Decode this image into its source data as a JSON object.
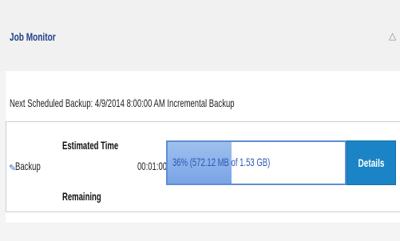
{
  "header": {
    "title": "Job Monitor",
    "collapse_icon": "collapse-up-icon"
  },
  "schedule": {
    "next_backup": "Next Scheduled Backup: 4/9/2014 8:00:00 AM Incremental Backup"
  },
  "job": {
    "type_icon": "backup-icon",
    "type_label": "Backup",
    "estimate_label_line1": "Estimated Time",
    "estimate_label_line2": "Remaining",
    "time_remaining": "00:01:00",
    "progress_fraction": 0.36,
    "progress_text": "36% (572.12 MB of 1.53 GB)",
    "details_label": "Details"
  },
  "colors": {
    "title": "#1f3f88",
    "progress_fill": "#7aa4e6",
    "progress_border": "#5e8ed6",
    "details_button": "#1a84c6"
  }
}
